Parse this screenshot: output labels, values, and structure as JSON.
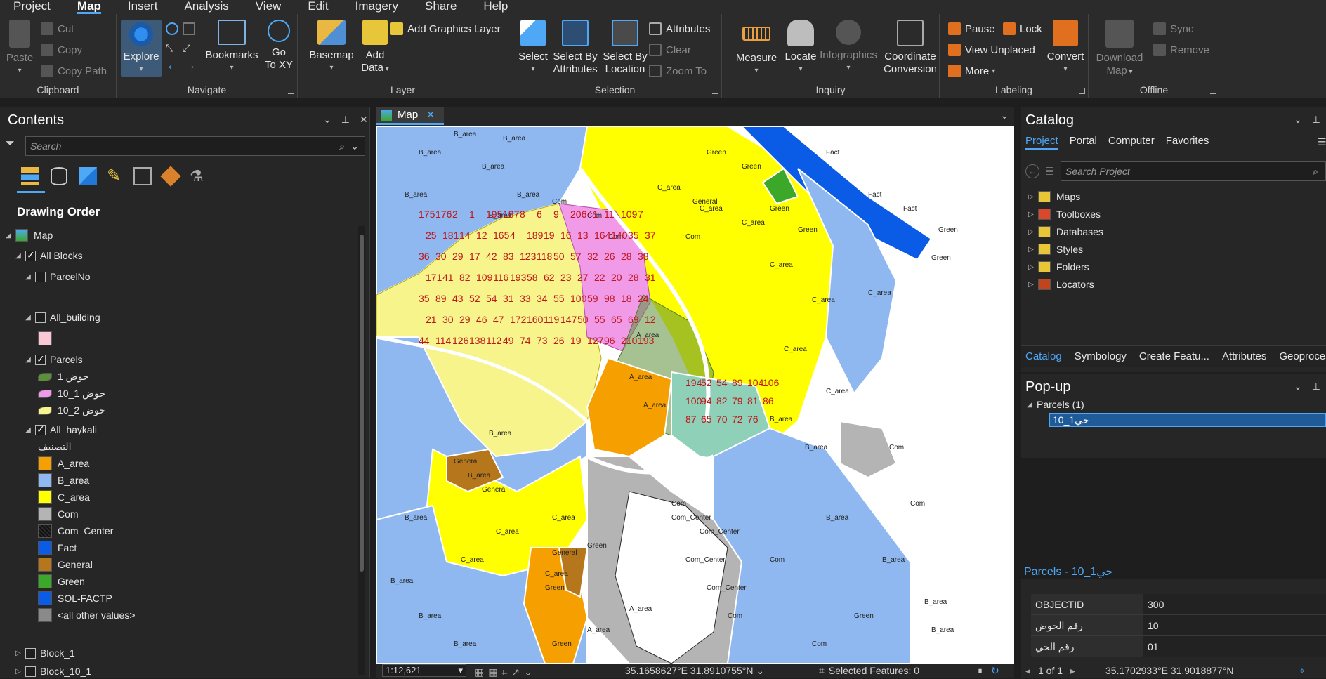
{
  "menu": {
    "tabs": [
      "Project",
      "Map",
      "Insert",
      "Analysis",
      "View",
      "Edit",
      "Imagery",
      "Share",
      "Help"
    ],
    "active": "Map"
  },
  "ribbon": {
    "clipboard": {
      "label": "Clipboard",
      "paste": "Paste",
      "cut": "Cut",
      "copy": "Copy",
      "copy_path": "Copy Path"
    },
    "navigate": {
      "label": "Navigate",
      "explore": "Explore",
      "bookmarks": "Bookmarks",
      "goto_xy_1": "Go",
      "goto_xy_2": "To XY"
    },
    "layer": {
      "label": "Layer",
      "basemap": "Basemap",
      "add_data_1": "Add",
      "add_data_2": "Data",
      "add_graphics": "Add Graphics Layer"
    },
    "selection": {
      "label": "Selection",
      "select": "Select",
      "by_attr_1": "Select By",
      "by_attr_2": "Attributes",
      "by_loc_1": "Select By",
      "by_loc_2": "Location",
      "attributes": "Attributes",
      "clear": "Clear",
      "zoom_to": "Zoom To"
    },
    "inquiry": {
      "label": "Inquiry",
      "measure": "Measure",
      "locate": "Locate",
      "infographics": "Infographics",
      "coord_1": "Coordinate",
      "coord_2": "Conversion"
    },
    "labeling": {
      "label": "Labeling",
      "pause": "Pause",
      "lock": "Lock",
      "view_unplaced": "View Unplaced",
      "more": "More",
      "convert": "Convert"
    },
    "offline": {
      "label": "Offline",
      "download_1": "Download",
      "download_2": "Map",
      "sync": "Sync",
      "remove": "Remove"
    }
  },
  "contents": {
    "title": "Contents",
    "search_placeholder": "Search",
    "drawing_order": "Drawing Order",
    "map_label": "Map",
    "layers": {
      "all_blocks": "All Blocks",
      "parcel_no": "ParcelNo",
      "all_building": "All_building",
      "parcels": "Parcels",
      "parcel_class_1": "حوض 1",
      "parcel_class_2": "حوض 1_10",
      "parcel_class_3": "حوض 2_10",
      "all_haykali": "All_haykali",
      "haykali_field": "التصنيف",
      "block_1": "Block_1",
      "block_10_1": "Block_10_1"
    },
    "legend": [
      {
        "label": "A_area",
        "color": "#f5a000"
      },
      {
        "label": "B_area",
        "color": "#8fb8f0"
      },
      {
        "label": "C_area",
        "color": "#ffff00"
      },
      {
        "label": "Com",
        "color": "#b4b4b4"
      },
      {
        "label": "Com_Center",
        "color": "#2a2a2a"
      },
      {
        "label": "Fact",
        "color": "#0a5ce6"
      },
      {
        "label": "General",
        "color": "#b5761c"
      },
      {
        "label": "Green",
        "color": "#3ca82a"
      },
      {
        "label": "SOL-FACTP",
        "color": "#0a5ce6"
      },
      {
        "label": "<all other values>",
        "color": "#8a8a8a"
      }
    ],
    "parcel_swatches": [
      "#5d8f3b",
      "#f09ae8",
      "#f6f48a"
    ],
    "building_swatch": "#f9c8d4"
  },
  "map_tab": {
    "label": "Map"
  },
  "map_labels": {
    "b_area": "B_area",
    "c_area": "C_area",
    "a_area": "A_area",
    "com": "Com",
    "com_center": "Com_Center",
    "green": "Green",
    "fact": "Fact",
    "general": "General",
    "parcel_numbers": [
      "175",
      "176",
      "2",
      "1",
      "195",
      "187",
      "8",
      "6",
      "9",
      "206",
      "41",
      "11",
      "109",
      "7",
      "25",
      "181",
      "14",
      "12",
      "165",
      "4",
      "189",
      "19",
      "16",
      "13",
      "164",
      "140",
      "35",
      "37",
      "36",
      "30",
      "29",
      "17",
      "42",
      "83",
      "123",
      "118",
      "50",
      "57",
      "32",
      "26",
      "28",
      "38",
      "171",
      "41",
      "82",
      "109",
      "116",
      "193",
      "58",
      "62",
      "23",
      "27",
      "22",
      "20",
      "28",
      "31",
      "35",
      "89",
      "43",
      "52",
      "54",
      "31",
      "33",
      "34",
      "55",
      "100",
      "59",
      "98",
      "18",
      "24",
      "21",
      "30",
      "29",
      "46",
      "47",
      "172",
      "160",
      "119",
      "147",
      "50",
      "55",
      "65",
      "69",
      "12",
      "44",
      "114",
      "126",
      "138",
      "112",
      "49",
      "74",
      "73",
      "26",
      "19",
      "127",
      "96",
      "210",
      "193",
      "194",
      "52",
      "54",
      "89",
      "104",
      "106",
      "100",
      "94",
      "82",
      "79",
      "81",
      "86",
      "87",
      "65",
      "70",
      "72",
      "76"
    ]
  },
  "status": {
    "scale": "1:12,621",
    "coords": "35.1658627°E 31.8910755°N",
    "selected": "Selected Features: 0"
  },
  "catalog": {
    "title": "Catalog",
    "tabs": [
      "Project",
      "Portal",
      "Computer",
      "Favorites"
    ],
    "active_tab": "Project",
    "search_placeholder": "Search Project",
    "items": [
      "Maps",
      "Toolboxes",
      "Databases",
      "Styles",
      "Folders",
      "Locators"
    ],
    "bottom_tabs": [
      "Catalog",
      "Symbology",
      "Create Featu...",
      "Attributes",
      "Geoprocessi"
    ]
  },
  "popup": {
    "title": "Pop-up",
    "layer_node": "Parcels (1)",
    "feature": "حي1_10",
    "header": "Parcels - حي1_10",
    "fields": [
      {
        "key": "OBJECTID",
        "value": "300"
      },
      {
        "key": "رقم الحوض",
        "value": "10"
      },
      {
        "key": "رقم الحي",
        "value": "01"
      }
    ],
    "pager": "1 of 1",
    "coords": "35.1702933°E 31.9018877°N"
  }
}
